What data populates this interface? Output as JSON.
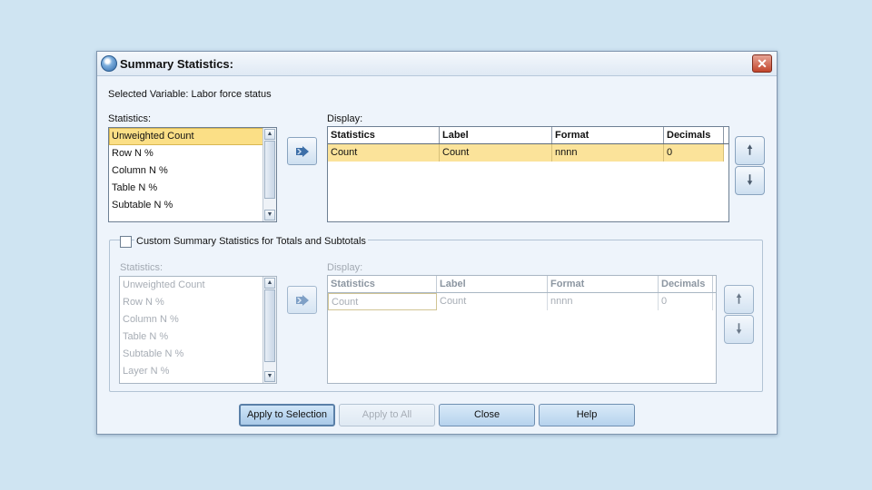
{
  "window": {
    "title": "Summary Statistics:",
    "close_glyph": "✕"
  },
  "selected_variable": "Selected Variable: Labor force status",
  "statistics_section": {
    "label": "Statistics:",
    "items": [
      "Unweighted Count",
      "Row N %",
      "Column N %",
      "Table N %",
      "Subtable N %"
    ],
    "selected_index": 0
  },
  "display_section": {
    "label": "Display:",
    "columns": [
      "Statistics",
      "Label",
      "Format",
      "Decimals"
    ],
    "rows": [
      [
        "Count",
        "Count",
        "nnnn",
        "0"
      ]
    ]
  },
  "custom_section": {
    "checkbox_label": "Custom Summary Statistics for Totals and Subtotals",
    "checked": false,
    "statistics_label": "Statistics:",
    "statistics_items": [
      "Unweighted Count",
      "Row N %",
      "Column N %",
      "Table N %",
      "Subtable N %",
      "Layer N %"
    ],
    "display_label": "Display:",
    "columns": [
      "Statistics",
      "Label",
      "Format",
      "Decimals"
    ],
    "rows": [
      [
        "Count",
        "Count",
        "nnnn",
        "0"
      ]
    ]
  },
  "icons": {
    "move_right": "arrow-right-icon",
    "move_up": "arrow-up-icon",
    "move_down": "arrow-down-icon",
    "up_glyph": "🠕",
    "down_glyph": "🠗"
  },
  "buttons": {
    "apply_selection": "Apply to Selection",
    "apply_all": "Apply to All",
    "close": "Close",
    "help": "Help"
  }
}
